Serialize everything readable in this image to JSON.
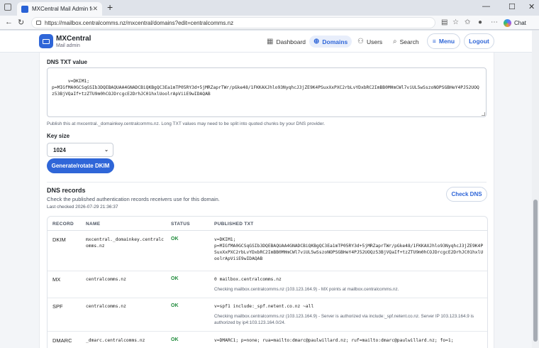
{
  "browser": {
    "tab_title": "MXCentral Mail Admin for CCL",
    "tab_close": "✕",
    "new_tab": "+",
    "url": "https://mailbox.centralcomms.nz/mxcentral/domains?edit=centralcomms.nz",
    "chat_label": "Chat",
    "win_min": "—",
    "win_max": "☐",
    "win_close": "✕"
  },
  "app": {
    "brand_title": "MXCentral",
    "brand_subtitle": "Mail admin",
    "nav": [
      {
        "label": "Dashboard",
        "icon": "dashboard-icon"
      },
      {
        "label": "Domains",
        "icon": "globe-icon"
      },
      {
        "label": "Users",
        "icon": "users-icon"
      },
      {
        "label": "Search",
        "icon": "search-icon"
      }
    ],
    "menu_label": "Menu",
    "logout_label": "Logout"
  },
  "dkim": {
    "txt_label": "DNS TXT value",
    "txt_value": "v=DKIM1;\np=MIGfMA0GCSqGSIb3DQEBAQUAA4GNADCBiQKBgQC3Ea1mTP05RY3d+5jMRZaprTWr/pGke48/1FKKAXJhlo93NyqhcJ3jZE9K4PSuxXxPXC2rbLvYDxbRC2ImBB0MHmCWl7viUL5wSszoNOPSGBHeY4PJ52UOQz53BjVQaIf+tzZTU9m0hCOJDrcgcE2DrhJC01hxlUoolrApViiE9wIDAQAB",
    "help_text": "Publish this at mxcentral._domainkey.centralcomms.nz. Long TXT values may need to be split into quoted chunks by your DNS provider.",
    "key_size_label": "Key size",
    "key_size_value": "1024",
    "generate_label": "Generate/rotate DKIM"
  },
  "dns": {
    "title": "DNS records",
    "subtitle": "Check the published authentication records receivers use for this domain.",
    "last_checked": "Last checked 2026-07-29 21:36:37",
    "check_label": "Check DNS",
    "columns": [
      "RECORD",
      "NAME",
      "STATUS",
      "PUBLISHED TXT"
    ],
    "rows": [
      {
        "record": "DKIM",
        "name": "mxcentral._domainkey.centralcomms.nz",
        "status": "OK",
        "published": "v=DKIM1;\np=MIGfMA0GCSqGSIb3DQEBAQUAA4GNADCBiQKBgQC3Ea1mTP05RY3d+5jMRZaprTWr/pGke48/1FKKAXJhlo93NyqhcJ3jZE9K4PSuxXxPXC2rbLvYDxbRC2ImBB0MHmCWl7viUL5wSszoNOPSGBHeY4PJ52UOQz53BjVQaIf+tzZTU9m0hCOJDrcgcE2DrhJC01hxlUoolrApViiE9wIDAQAB",
        "note": ""
      },
      {
        "record": "MX",
        "name": "centralcomms.nz",
        "status": "OK",
        "published": "0 mailbox.centralcomms.nz",
        "note": "Checking mailbox.centralcomms.nz (103.123.164.9) - MX points at mailbox.centralcomms.nz."
      },
      {
        "record": "SPF",
        "name": "centralcomms.nz",
        "status": "OK",
        "published": "v=spf1 include:_spf.netent.co.nz ~all",
        "note": "Checking mailbox.centralcomms.nz (103.123.164.9) - Server is authorized via include:_spf.netent.co.nz. Server IP 103.123.164.9 is authorized by ip4:103.123.164.0/24."
      },
      {
        "record": "DMARC",
        "name": "_dmarc.centralcomms.nz",
        "status": "OK",
        "published": "v=DMARC1; p=none; rua=mailto:dmarc@paulwillard.nz; ruf=mailto:dmarc@paulwillard.nz; fo=1;",
        "note": ""
      }
    ]
  },
  "colors": {
    "accent": "#2f66d8",
    "ok": "#1e8a3a"
  }
}
